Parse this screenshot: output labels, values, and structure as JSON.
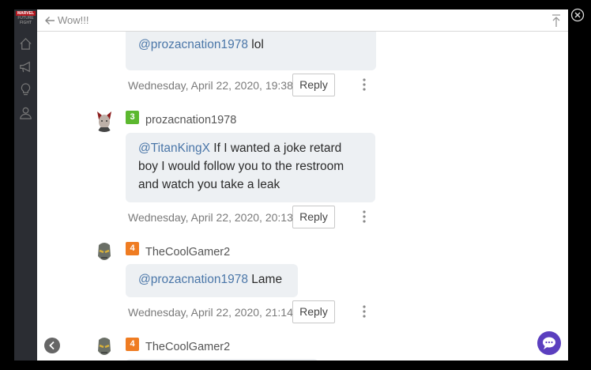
{
  "app": {
    "logo_text": "FUTURE",
    "logo_brand": "MARVEL",
    "logo_sub": "FIGHT"
  },
  "header": {
    "title": "Wow!!!"
  },
  "posts": [
    {
      "text_mention": "@prozacnation1978",
      "text_rest": " lol",
      "date": "Wednesday, April 22, 2020, 19:38",
      "reply_label": "Reply"
    },
    {
      "rank": "3",
      "rank_color": "#5cb82f",
      "username": "prozacnation1978",
      "text_mention": "@TitanKingX",
      "text_rest": " If I wanted a joke retard boy I would follow you to the restroom and watch you take a leak",
      "date": "Wednesday, April 22, 2020, 20:13",
      "reply_label": "Reply"
    },
    {
      "rank": "4",
      "rank_color": "#ef7c22",
      "username": "TheCoolGamer2",
      "text_mention": "@prozacnation1978",
      "text_rest": " Lame",
      "date": "Wednesday, April 22, 2020, 21:14",
      "reply_label": "Reply"
    },
    {
      "rank": "4",
      "rank_color": "#ef7c22",
      "username": "TheCoolGamer2"
    }
  ],
  "icons": {
    "back": "arrow-left-icon",
    "to_top": "scroll-to-top-icon",
    "close": "close-circle-icon",
    "chat": "chat-bubble-icon",
    "nav": [
      "home-icon",
      "megaphone-icon",
      "lightbulb-icon",
      "user-icon"
    ]
  },
  "colors": {
    "accent": "#5b3fbf",
    "mention": "#4a76a8",
    "bubble_bg": "#edf0f3"
  }
}
